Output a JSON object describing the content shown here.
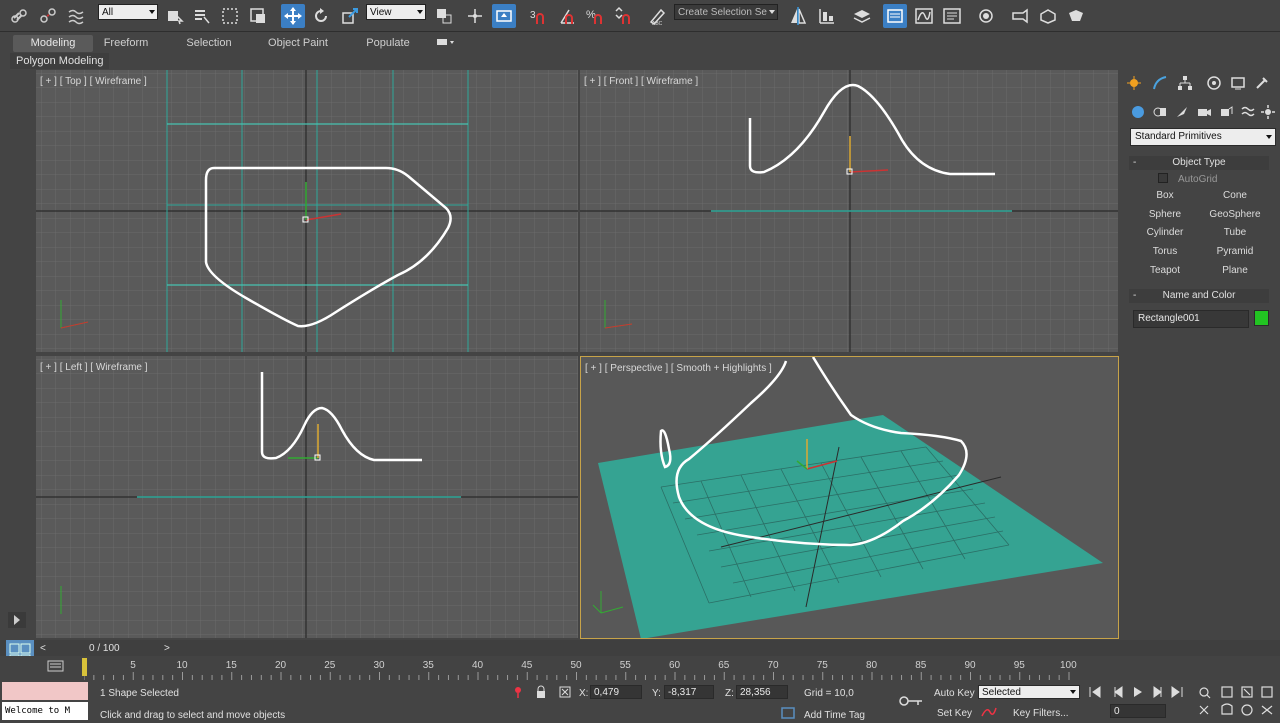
{
  "toolbar": {
    "selection_filter": "All",
    "reference_coord": "View",
    "named_selection_placeholder": "Create Selection Se",
    "icons": [
      "link-icon",
      "unlink-icon",
      "bind-spacewarp-icon",
      "select-object-icon",
      "select-by-name-icon",
      "rect-region-icon",
      "window-crossing-icon",
      "move-icon",
      "rotate-icon",
      "scale-icon",
      "pivot-icon",
      "manipulate-icon",
      "snaps-3-icon",
      "angle-snap-icon",
      "percent-snap-icon",
      "spinner-snap-icon",
      "edit-named-sel-icon",
      "mirror-icon",
      "align-icon",
      "layer-explorer-icon",
      "scene-explorer-icon",
      "curve-editor-icon",
      "schematic-icon",
      "material-editor-icon",
      "render-setup-icon",
      "rendered-frame-icon",
      "render-icon"
    ]
  },
  "ribbon": {
    "tabs": [
      "Modeling",
      "Freeform",
      "Selection",
      "Object Paint",
      "Populate"
    ],
    "active_tab": "Modeling",
    "panel_label": "Polygon Modeling"
  },
  "viewports": {
    "top": "[ + ] [ Top ] [ Wireframe ]",
    "front": "[ + ] [ Front ] [ Wireframe ]",
    "left": "[ + ] [ Left ] [ Wireframe ]",
    "perspective": "[ + ] [ Perspective ] [ Smooth + Highlights ]"
  },
  "command_panel": {
    "category_dropdown": "Standard Primitives",
    "object_type_title": "Object Type",
    "autogrid_label": "AutoGrid",
    "buttons": [
      "Box",
      "Cone",
      "Sphere",
      "GeoSphere",
      "Cylinder",
      "Tube",
      "Torus",
      "Pyramid",
      "Teapot",
      "Plane"
    ],
    "name_color_title": "Name and Color",
    "object_name": "Rectangle001",
    "object_color": "#22c422"
  },
  "timeline": {
    "frame_counter": "0 / 100",
    "ticks": [
      "5",
      "10",
      "15",
      "20",
      "25",
      "30",
      "35",
      "40",
      "45",
      "50",
      "55",
      "60",
      "65",
      "70",
      "75",
      "80",
      "85",
      "90",
      "95",
      "100"
    ]
  },
  "status": {
    "maxscript_text": "Welcome to M",
    "selection_info": "1 Shape Selected",
    "prompt": "Click and drag to select and move objects",
    "x_label": "X:",
    "x_value": "0,479",
    "y_label": "Y:",
    "y_value": "-8,317",
    "z_label": "Z:",
    "z_value": "28,356",
    "grid_text": "Grid = 10,0",
    "add_time_tag": "Add Time Tag",
    "auto_key": "Auto Key",
    "set_key": "Set Key",
    "selected_dropdown": "Selected",
    "key_filters": "Key Filters...",
    "current_frame": "0"
  },
  "colors": {
    "plane_teal": "#35a392",
    "active_viewport_border": "#c7a349",
    "toolbar_active": "#3b7fc4"
  }
}
